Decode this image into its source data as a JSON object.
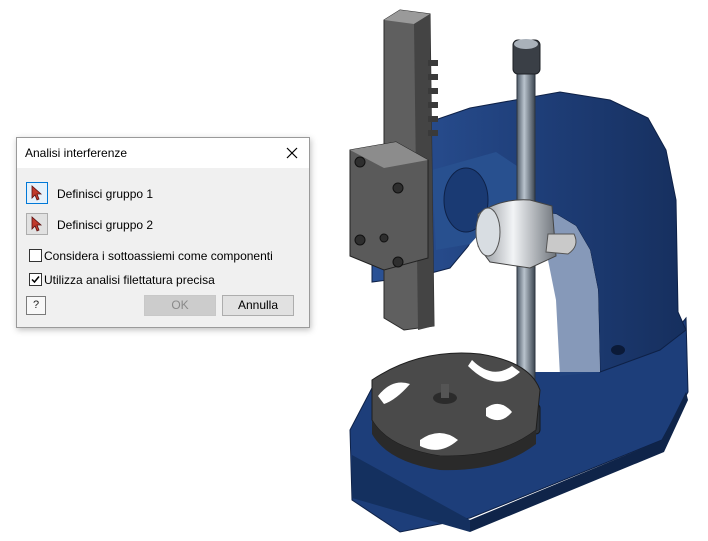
{
  "viewport": {
    "model": "arbor-press-model",
    "colors": {
      "frame": "#1c3f7c",
      "tooling": "#5a5a5a",
      "rod": "#7d8a99"
    }
  },
  "dialog": {
    "title": "Analisi interferenze",
    "close_icon": "close-icon",
    "group1_label": "Definisci gruppo 1",
    "group2_label": "Definisci gruppo 2",
    "option_subassemblies": {
      "label": "Considera i sottoassiemi come componenti",
      "checked": false
    },
    "option_thread": {
      "label": "Utilizza analisi filettatura precisa",
      "checked": true
    },
    "help_label": "?",
    "ok_label": "OK",
    "cancel_label": "Annulla",
    "highlight_color": "#e0393e"
  }
}
